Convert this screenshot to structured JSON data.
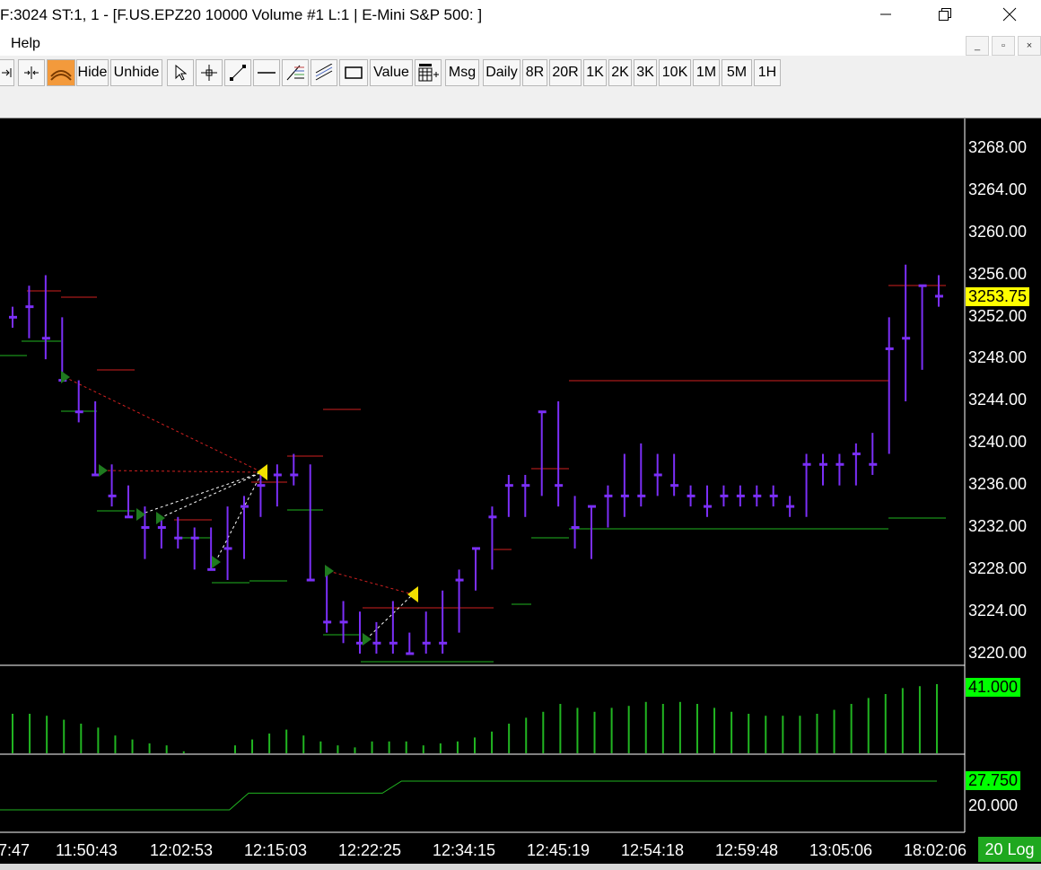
{
  "window": {
    "title": "F:3024  ST:1, 1 - [F.US.EPZ20  10000 Volume  #1  L:1 | E-Mini S&P 500: ]",
    "minimize_icon": "minimize-icon",
    "restore_icon": "restore-icon",
    "close_icon": "close-icon"
  },
  "menu": {
    "items": [
      "Help"
    ]
  },
  "toolbar": {
    "hide": "Hide",
    "unhide": "Unhide",
    "value": "Value",
    "msg": "Msg",
    "daily": "Daily",
    "bars": [
      "8R",
      "20R",
      "1K",
      "2K",
      "3K",
      "10K",
      "1M",
      "5M",
      "1H"
    ],
    "icons": [
      "scroll-end-icon",
      "compress-bars-icon",
      "arc-draw-icon",
      "pointer-icon",
      "crosshair-icon",
      "line-tool-icon",
      "horizontal-line-icon",
      "fib-tool-icon",
      "channel-tool-icon",
      "rectangle-tool-icon",
      "bar-chart-add-icon"
    ]
  },
  "chart_data": [
    {
      "type": "ohlc",
      "title": "",
      "ylim": [
        3218,
        3270
      ],
      "y_ticks": [
        "3268.00",
        "3264.00",
        "3260.00",
        "3256.00",
        "3252.00",
        "3248.00",
        "3244.00",
        "3240.00",
        "3236.00",
        "3232.00",
        "3228.00",
        "3224.00",
        "3220.00"
      ],
      "last_price": "3253.75",
      "bars": [
        {
          "h": 3253,
          "l": 3251,
          "c": 3252
        },
        {
          "h": 3255,
          "l": 3250,
          "c": 3253
        },
        {
          "h": 3256,
          "l": 3248,
          "c": 3250
        },
        {
          "h": 3252,
          "l": 3246,
          "c": 3246
        },
        {
          "h": 3246,
          "l": 3242,
          "c": 3243
        },
        {
          "h": 3244,
          "l": 3237,
          "c": 3237
        },
        {
          "h": 3238,
          "l": 3234,
          "c": 3235
        },
        {
          "h": 3236,
          "l": 3233,
          "c": 3233
        },
        {
          "h": 3234,
          "l": 3229,
          "c": 3232
        },
        {
          "h": 3233,
          "l": 3230,
          "c": 3232
        },
        {
          "h": 3233,
          "l": 3230,
          "c": 3231
        },
        {
          "h": 3232,
          "l": 3228,
          "c": 3231
        },
        {
          "h": 3232,
          "l": 3228,
          "c": 3228
        },
        {
          "h": 3234,
          "l": 3227,
          "c": 3230
        },
        {
          "h": 3235,
          "l": 3229,
          "c": 3234
        },
        {
          "h": 3237,
          "l": 3233,
          "c": 3236
        },
        {
          "h": 3238,
          "l": 3234,
          "c": 3237
        },
        {
          "h": 3239,
          "l": 3236,
          "c": 3237
        },
        {
          "h": 3238,
          "l": 3227,
          "c": 3227
        },
        {
          "h": 3228,
          "l": 3222,
          "c": 3223
        },
        {
          "h": 3225,
          "l": 3221,
          "c": 3223
        },
        {
          "h": 3224,
          "l": 3220,
          "c": 3221
        },
        {
          "h": 3223,
          "l": 3220,
          "c": 3221
        },
        {
          "h": 3225,
          "l": 3220,
          "c": 3221
        },
        {
          "h": 3222,
          "l": 3220,
          "c": 3220
        },
        {
          "h": 3224,
          "l": 3220,
          "c": 3221
        },
        {
          "h": 3226,
          "l": 3220,
          "c": 3221
        },
        {
          "h": 3228,
          "l": 3222,
          "c": 3227
        },
        {
          "h": 3230,
          "l": 3226,
          "c": 3230
        },
        {
          "h": 3234,
          "l": 3228,
          "c": 3233
        },
        {
          "h": 3237,
          "l": 3233,
          "c": 3236
        },
        {
          "h": 3237,
          "l": 3233,
          "c": 3236
        },
        {
          "h": 3243,
          "l": 3235,
          "c": 3243
        },
        {
          "h": 3244,
          "l": 3234,
          "c": 3236
        },
        {
          "h": 3235,
          "l": 3230,
          "c": 3232
        },
        {
          "h": 3234,
          "l": 3229,
          "c": 3234
        },
        {
          "h": 3236,
          "l": 3232,
          "c": 3235
        },
        {
          "h": 3239,
          "l": 3233,
          "c": 3235
        },
        {
          "h": 3240,
          "l": 3234,
          "c": 3235
        },
        {
          "h": 3239,
          "l": 3235,
          "c": 3237
        },
        {
          "h": 3239,
          "l": 3235,
          "c": 3236
        },
        {
          "h": 3236,
          "l": 3234,
          "c": 3235
        },
        {
          "h": 3236,
          "l": 3233,
          "c": 3234
        },
        {
          "h": 3236,
          "l": 3234,
          "c": 3235
        },
        {
          "h": 3236,
          "l": 3234,
          "c": 3235
        },
        {
          "h": 3236,
          "l": 3234,
          "c": 3235
        },
        {
          "h": 3236,
          "l": 3234,
          "c": 3235
        },
        {
          "h": 3235,
          "l": 3233,
          "c": 3234
        },
        {
          "h": 3239,
          "l": 3233,
          "c": 3238
        },
        {
          "h": 3239,
          "l": 3236,
          "c": 3238
        },
        {
          "h": 3239,
          "l": 3236,
          "c": 3238
        },
        {
          "h": 3240,
          "l": 3236,
          "c": 3239
        },
        {
          "h": 3241,
          "l": 3237,
          "c": 3238
        },
        {
          "h": 3252,
          "l": 3239,
          "c": 3249
        },
        {
          "h": 3257,
          "l": 3244,
          "c": 3250
        },
        {
          "h": 3255,
          "l": 3247,
          "c": 3255
        },
        {
          "h": 3256,
          "l": 3253,
          "c": 3254
        }
      ],
      "x_ticks": [
        "7:47",
        "11:50:43",
        "12:02:53",
        "12:15:03",
        "12:22:25",
        "12:34:15",
        "12:45:19",
        "12:54:18",
        "12:59:48",
        "13:05:06",
        "18:02:06"
      ]
    },
    {
      "type": "bar",
      "name": "volume-study",
      "last_value": "41.000",
      "values": [
        40,
        40,
        38,
        34,
        30,
        26,
        18,
        14,
        10,
        8,
        2,
        0,
        0,
        8,
        14,
        20,
        24,
        18,
        12,
        8,
        6,
        12,
        12,
        12,
        8,
        10,
        12,
        16,
        22,
        30,
        36,
        42,
        50,
        46,
        42,
        46,
        48,
        52,
        50,
        52,
        50,
        46,
        42,
        40,
        38,
        38,
        38,
        40,
        44,
        50,
        56,
        60,
        66,
        68,
        70
      ]
    },
    {
      "type": "line",
      "name": "step-study",
      "last_value": "27.750",
      "y_tick": "20.000",
      "values": [
        20,
        20,
        20,
        20,
        20,
        20,
        20,
        20,
        20,
        20,
        20,
        20,
        20,
        24.5,
        24.5,
        24.5,
        24.5,
        24.5,
        24.5,
        24.5,
        24.5,
        27.75,
        27.75,
        27.75,
        27.75,
        27.75,
        27.75,
        27.75,
        27.75,
        27.75,
        27.75,
        27.75,
        27.75,
        27.75,
        27.75,
        27.75,
        27.75,
        27.75,
        27.75,
        27.75,
        27.75,
        27.75,
        27.75,
        27.75,
        27.75,
        27.75,
        27.75,
        27.75,
        27.75,
        27.75
      ]
    }
  ],
  "scale_button": "20 Log",
  "colors": {
    "bar": "#7b2ff7",
    "support": "#21b521",
    "resistance": "#d02020",
    "signal_long": "#1f7a1f",
    "signal_short": "#f2e000",
    "last_price_bg": "#ffff00",
    "study_bg": "#00ff00"
  }
}
